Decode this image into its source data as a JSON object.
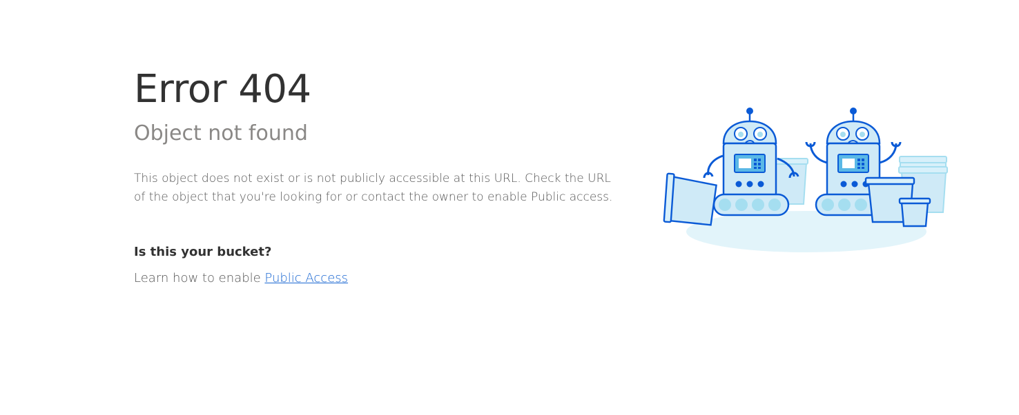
{
  "error": {
    "title": "Error 404",
    "subtitle": "Object not found",
    "description": "This object does not exist or is not publicly accessible at this URL. Check the URL of the object that you're looking for or contact the owner to enable Public access."
  },
  "bucket": {
    "heading": "Is this your bucket?",
    "learn_prefix": "Learn how to enable ",
    "link_label": "Public Access"
  },
  "illustration": {
    "icon": "sad-robots-illustration",
    "colors": {
      "outline": "#0a5ad6",
      "fill": "#cfeaf7",
      "light": "#a5def0",
      "floor": "#e2f4fa"
    }
  }
}
